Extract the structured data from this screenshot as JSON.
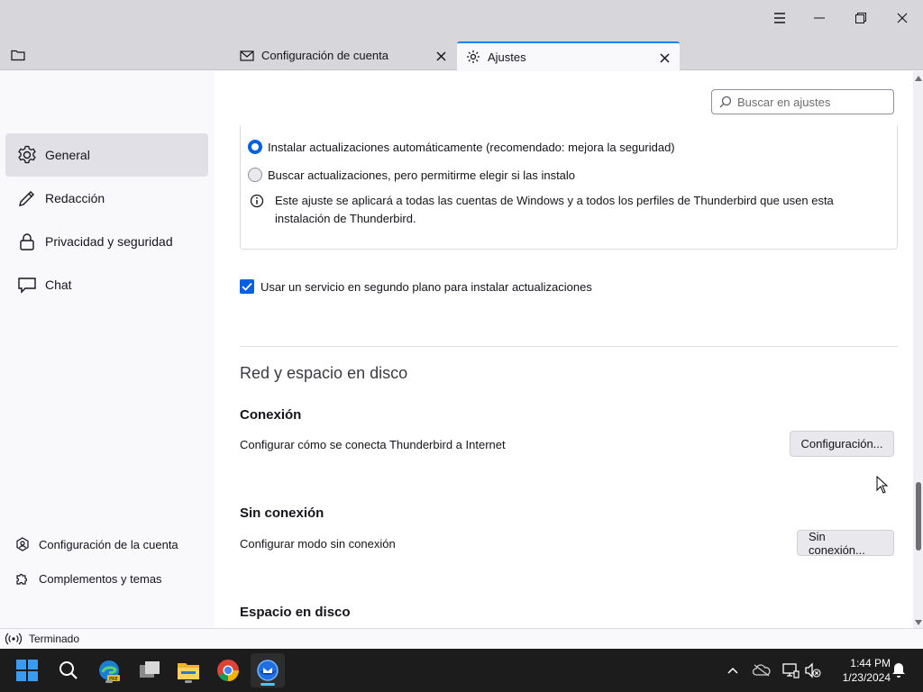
{
  "tabs": [
    {
      "label": "Configuración de cuenta",
      "icon": "mail-settings-icon"
    },
    {
      "label": "Ajustes",
      "icon": "gear-icon",
      "active": true
    }
  ],
  "sidebar": {
    "items": [
      {
        "label": "General",
        "icon": "gear-icon",
        "selected": true
      },
      {
        "label": "Redacción",
        "icon": "pencil-icon"
      },
      {
        "label": "Privacidad y seguridad",
        "icon": "lock-icon"
      },
      {
        "label": "Chat",
        "icon": "chat-icon"
      }
    ],
    "bottom": [
      {
        "label": "Configuración de la cuenta",
        "icon": "account-settings-icon"
      },
      {
        "label": "Complementos y temas",
        "icon": "puzzle-icon"
      }
    ]
  },
  "search": {
    "placeholder": "Buscar en ajustes"
  },
  "updates": {
    "option_auto": "Instalar actualizaciones automáticamente (recomendado: mejora la seguridad)",
    "option_manual": "Buscar actualizaciones, pero permitirme elegir si las instalo",
    "info": "Este ajuste se aplicará a todas las cuentas de Windows y a todos los perfiles de Thunderbird que usen esta instalación de Thunderbird.",
    "background_service": "Usar un servicio en segundo plano para instalar actualizaciones"
  },
  "network": {
    "section_title": "Red y espacio en disco",
    "connection_title": "Conexión",
    "connection_desc": "Configurar cómo se conecta Thunderbird a Internet",
    "connection_button": "Configuración...",
    "offline_title": "Sin conexión",
    "offline_desc": "Configurar modo sin conexión",
    "offline_button": "Sin conexión...",
    "disk_title": "Espacio en disco"
  },
  "status": {
    "text": "Terminado"
  },
  "clock": {
    "time": "1:44 PM",
    "date": "1/23/2024"
  },
  "colors": {
    "accent": "#0060df",
    "tab_accent": "#0a84ff",
    "taskbar": "#1c1c1c"
  }
}
